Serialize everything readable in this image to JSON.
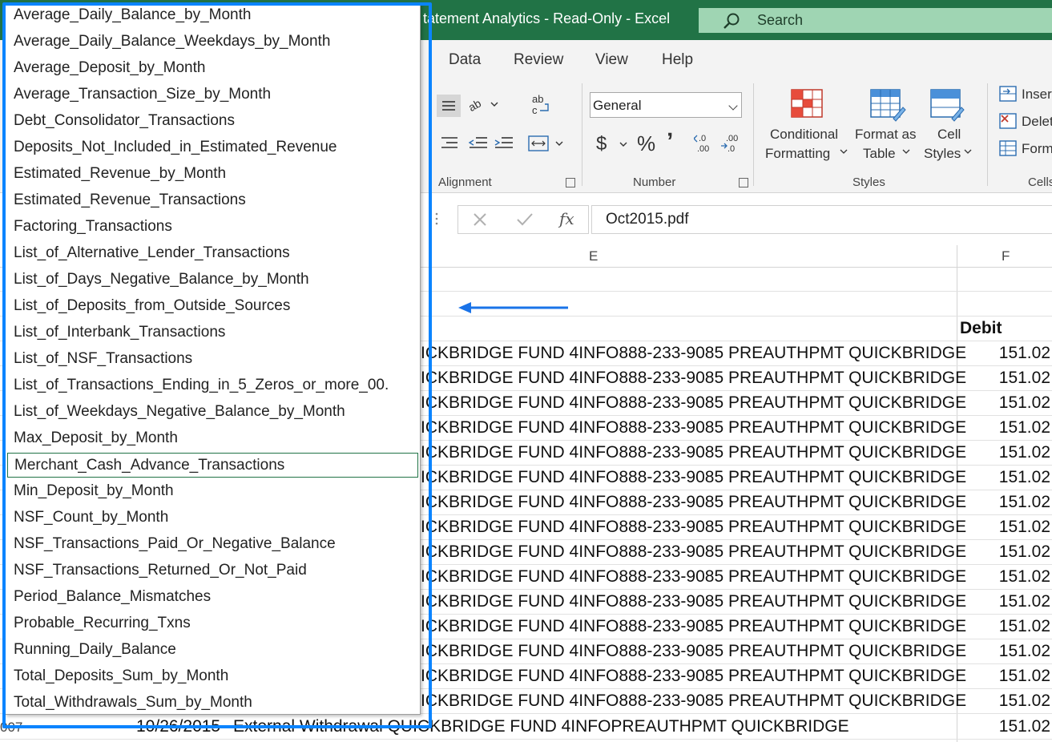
{
  "title": {
    "text": "Statement Analytics  -  Read-Only  -  Excel",
    "visible_text": "tatement Analytics  -  Read-Only  -  Excel"
  },
  "search": {
    "label": "Search"
  },
  "menu": {
    "tabs": [
      "Data",
      "Review",
      "View",
      "Help"
    ]
  },
  "ribbon": {
    "alignment_label": "Alignment",
    "number_label": "Number",
    "styles_label": "Styles",
    "cells_label": "Cells",
    "number_format": "General",
    "currency": "$",
    "percent": "%",
    "comma": "ʼ",
    "conditional_formatting": [
      "Conditional",
      "Formatting"
    ],
    "format_as_table": [
      "Format as",
      "Table"
    ],
    "cell_styles": [
      "Cell",
      "Styles"
    ],
    "insert": "Inser",
    "delete": "Delet",
    "format": "Form"
  },
  "formula_bar": {
    "fx": "fx",
    "value": "Oct2015.pdf"
  },
  "columns": {
    "e": "E",
    "f": "F"
  },
  "sheet": {
    "debit_header": "Debit",
    "row_description": "ICKBRIDGE FUND 4INFO888-233-9085 PREAUTHPMT QUICKBRIDGE",
    "rows": [
      {
        "amount": "151.02"
      },
      {
        "amount": "151.02"
      },
      {
        "amount": "151.02"
      },
      {
        "amount": "151.02"
      },
      {
        "amount": "151.02"
      },
      {
        "amount": "151.02"
      },
      {
        "amount": "151.02"
      },
      {
        "amount": "151.02"
      },
      {
        "amount": "151.02"
      },
      {
        "amount": "151.02"
      },
      {
        "amount": "151.02"
      },
      {
        "amount": "151.02"
      },
      {
        "amount": "151.02"
      },
      {
        "amount": "151.02"
      },
      {
        "amount": "151.02"
      }
    ],
    "last_row": {
      "row_number": "007",
      "date": "10/26/2015",
      "description": "External Withdrawal QUICKBRIDGE FUND 4INFOPREAUTHPMT QUICKBRIDGE",
      "amount": "151.02"
    }
  },
  "dropdown": {
    "selected_index": 17,
    "items": [
      "Average_Daily_Balance_by_Month",
      "Average_Daily_Balance_Weekdays_by_Month",
      "Average_Deposit_by_Month",
      "Average_Transaction_Size_by_Month",
      "Debt_Consolidator_Transactions",
      "Deposits_Not_Included_in_Estimated_Revenue",
      "Estimated_Revenue_by_Month",
      "Estimated_Revenue_Transactions",
      "Factoring_Transactions",
      "List_of_Alternative_Lender_Transactions",
      "List_of_Days_Negative_Balance_by_Month",
      "List_of_Deposits_from_Outside_Sources",
      "List_of_Interbank_Transactions",
      "List_of_NSF_Transactions",
      "List_of_Transactions_Ending_in_5_Zeros_or_more_00.",
      "List_of_Weekdays_Negative_Balance_by_Month",
      "Max_Deposit_by_Month",
      "Merchant_Cash_Advance_Transactions",
      "Min_Deposit_by_Month",
      "NSF_Count_by_Month",
      "NSF_Transactions_Paid_Or_Negative_Balance",
      "NSF_Transactions_Returned_Or_Not_Paid",
      "Period_Balance_Mismatches",
      "Probable_Recurring_Txns",
      "Running_Daily_Balance",
      "Total_Deposits_Sum_by_Month",
      "Total_Withdrawals_Sum_by_Month"
    ]
  },
  "colors": {
    "excel_green": "#217346",
    "highlight_blue": "#0a84ff",
    "arrow_blue": "#1a73e8"
  }
}
